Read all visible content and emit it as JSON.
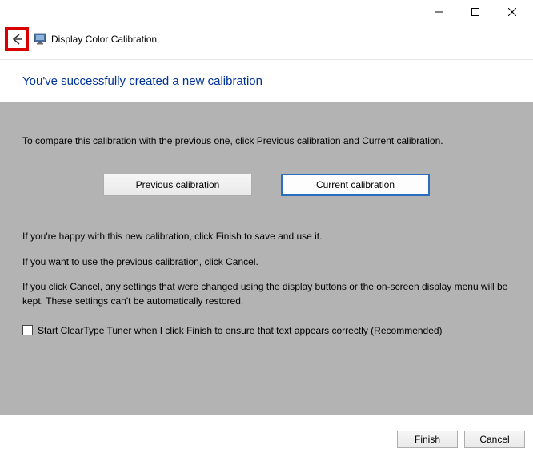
{
  "header": {
    "app_title": "Display Color Calibration"
  },
  "page": {
    "title": "You've successfully created a new calibration"
  },
  "panel": {
    "intro": "To compare this calibration with the previous one, click Previous calibration and Current calibration.",
    "prev_btn": "Previous calibration",
    "curr_btn": "Current calibration",
    "happy": "If you're happy with this new calibration, click Finish to save and use it.",
    "want_prev": "If you want to use the previous calibration, click Cancel.",
    "cancel_note": "If you click Cancel, any settings that were changed using the display buttons or the on-screen display menu will be kept. These settings can't be automatically restored.",
    "cleartype_label": "Start ClearType Tuner when I click Finish to ensure that text appears correctly (Recommended)"
  },
  "footer": {
    "finish": "Finish",
    "cancel": "Cancel"
  }
}
